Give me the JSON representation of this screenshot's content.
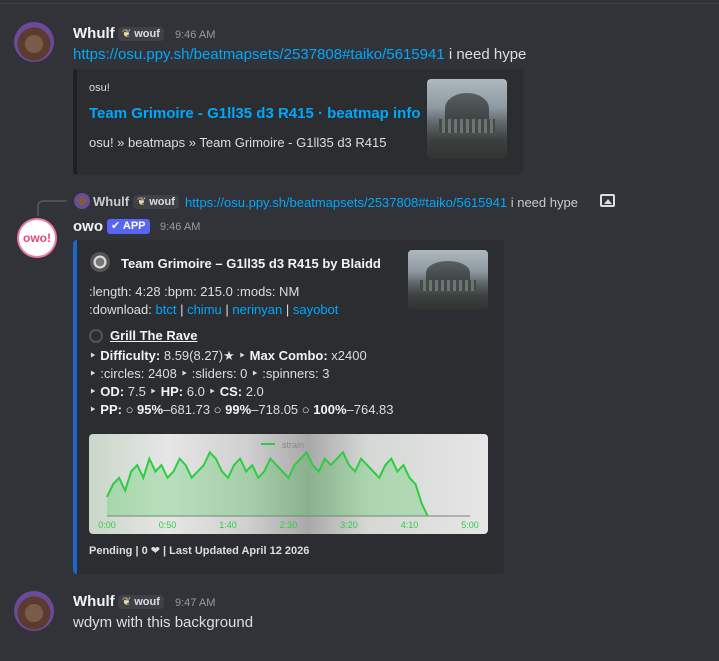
{
  "messages": [
    {
      "author": "Whulf",
      "tag": "wouf",
      "time": "9:46 AM",
      "link": "https://osu.ppy.sh/beatmapsets/2537808#taiko/5615941",
      "text": " i need hype",
      "embed": {
        "provider": "osu!",
        "title": "Team Grimoire - G1ll35 d3 R415 · beatmap info",
        "description": "osu! » beatmaps » Team Grimoire - G1ll35 d3 R415"
      }
    },
    {
      "reply": {
        "author": "Whulf",
        "tag": "wouf",
        "link": "https://osu.ppy.sh/beatmapsets/2537808#taiko/5615941",
        "text": " i need hype"
      },
      "author": "owo",
      "app_badge": "APP",
      "avatar_text": "owo!",
      "time": "9:46 AM",
      "embed": {
        "title": "Team Grimoire – G1ll35 d3 R415 by Blaidd",
        "length_line": ":length: 4:28 :bpm: 215.0 :mods: NM",
        "download_label": ":download: ",
        "download_links": [
          "btct",
          "chimu",
          "nerinyan",
          "sayobot"
        ],
        "difficulty_name": "Grill The Rave",
        "stats": {
          "difficulty_label": "Difficulty:",
          "difficulty_value": " 8.59(8.27)★",
          "maxcombo_label": "Max Combo:",
          "maxcombo_value": " x2400",
          "counts": ":circles: 2408 ‣ :sliders: 0 ‣ :spinners: 3",
          "od_label": "OD:",
          "od_value": " 7.5",
          "hp_label": "HP:",
          "hp_value": " 6.0",
          "cs_label": "CS:",
          "cs_value": " 2.0",
          "pp_label": "PP:",
          "pp_95_label": "95%",
          "pp_95_value": "–681.73",
          "pp_99_label": "99%",
          "pp_99_value": "–718.05",
          "pp_100_label": "100%",
          "pp_100_value": "–764.83"
        },
        "footer": "Pending | 0 ❤ | Last Updated April 12 2026"
      }
    },
    {
      "author": "Whulf",
      "tag": "wouf",
      "time": "9:47 AM",
      "text": "wdym with this background"
    }
  ],
  "chart_data": {
    "type": "line",
    "series": [
      {
        "name": "strain",
        "x": [
          0,
          5,
          10,
          15,
          20,
          25,
          30,
          35,
          40,
          45,
          50,
          55,
          60,
          65,
          70,
          75,
          80,
          85,
          90,
          95,
          100,
          105,
          110,
          115,
          120,
          125,
          130,
          135,
          140,
          145,
          150,
          155,
          160,
          165,
          170,
          175,
          180,
          185,
          190,
          195,
          200,
          205,
          210,
          215,
          220,
          225,
          230,
          235,
          240,
          245,
          250,
          255,
          260,
          265
        ],
        "values": [
          3,
          5,
          6,
          4,
          7,
          8,
          6,
          9,
          7,
          8,
          6,
          7,
          9,
          8,
          6,
          7,
          8,
          10,
          9,
          7,
          6,
          8,
          9,
          7,
          8,
          6,
          7,
          9,
          8,
          7,
          6,
          8,
          9,
          10,
          8,
          7,
          9,
          8,
          9,
          10,
          8,
          7,
          9,
          8,
          7,
          6,
          8,
          9,
          7,
          8,
          6,
          5,
          2,
          0
        ]
      }
    ],
    "xticks": [
      "0:00",
      "0:50",
      "1:40",
      "2:30",
      "3:20",
      "4:10",
      "5:00"
    ],
    "line_color": "#2ecc40"
  },
  "colors": {
    "embed_bar_1": "#1e1f22",
    "embed_bar_2": "#1e66c9"
  },
  "icons": [
    "leaf-icon",
    "checkmark-icon",
    "image-icon",
    "heart-icon"
  ]
}
